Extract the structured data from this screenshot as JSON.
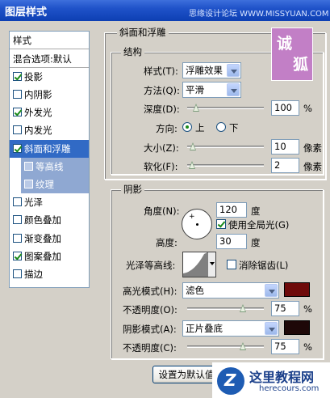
{
  "window": {
    "title": "图层样式",
    "watermark": "思缘设计论坛 WWW.MISSYUAN.COM"
  },
  "watermark_logo": {
    "line1": "诚",
    "line2": "狐"
  },
  "sidebar": {
    "header": "样式",
    "blend_label": "混合选项:默认",
    "items": [
      {
        "label": "投影",
        "checked": true
      },
      {
        "label": "内阴影",
        "checked": false
      },
      {
        "label": "外发光",
        "checked": true
      },
      {
        "label": "内发光",
        "checked": false
      },
      {
        "label": "斜面和浮雕",
        "checked": true
      },
      {
        "label": "等高线",
        "checked": false
      },
      {
        "label": "纹理",
        "checked": false
      },
      {
        "label": "光泽",
        "checked": false
      },
      {
        "label": "颜色叠加",
        "checked": false
      },
      {
        "label": "渐变叠加",
        "checked": false
      },
      {
        "label": "图案叠加",
        "checked": true
      },
      {
        "label": "描边",
        "checked": false
      }
    ]
  },
  "bevel": {
    "group_title": "斜面和浮雕",
    "structure_title": "结构",
    "style_label": "样式(T):",
    "style_value": "浮雕效果",
    "technique_label": "方法(Q):",
    "technique_value": "平滑",
    "depth_label": "深度(D):",
    "depth_value": "100",
    "depth_unit": "%",
    "depth_level": 0.08,
    "direction_label": "方向:",
    "dir_up": "上",
    "dir_down": "下",
    "size_label": "大小(Z):",
    "size_value": "10",
    "size_unit": "像素",
    "size_level": 0.04,
    "soften_label": "软化(F):",
    "soften_value": "2",
    "soften_unit": "像素",
    "soften_level": 0.02
  },
  "shading": {
    "title": "阴影",
    "angle_label": "角度(N):",
    "angle_value": "120",
    "angle_unit": "度",
    "global_light_label": "使用全局光(G)",
    "altitude_label": "高度:",
    "altitude_value": "30",
    "altitude_unit": "度",
    "gloss_label": "光泽等高线:",
    "antialias_label": "消除锯齿(L)",
    "highlight_label": "高光模式(H):",
    "highlight_mode": "滤色",
    "highlight_color": "#6e0a0a",
    "opacity1_label": "不透明度(O):",
    "opacity1_value": "75",
    "opacity1_unit": "%",
    "opacity1_level": 0.75,
    "shadow_label": "阴影模式(A):",
    "shadow_mode": "正片叠底",
    "shadow_color": "#1e0808",
    "opacity2_label": "不透明度(C):",
    "opacity2_value": "75",
    "opacity2_unit": "%",
    "opacity2_level": 0.75
  },
  "buttons": {
    "set_default": "设置为默认值"
  },
  "site_logo": {
    "name": "这里教程网",
    "url": "herecours.com",
    "mark": "Z"
  }
}
